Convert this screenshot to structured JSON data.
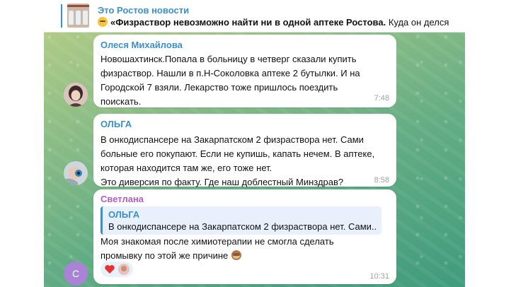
{
  "pinned": {
    "title": "Это Ростов новости",
    "bold_text": "«Физраствор невозможно найти ни в одной аптеке Ростова.",
    "rest_text": " Куда он делся"
  },
  "messages": [
    {
      "author": "Олеся Михайлова",
      "author_color": "#3a8fd1",
      "lines": [
        "Новошахтинск.Попала в больницу в четверг сказали купить",
        "физраствор. Нашли в п.Н-Соколовка аптеке 2 бутылки. И на",
        "Городской 7 взяли. Лекарство тоже пришлось поездить",
        "поискать."
      ],
      "time": "7:48"
    },
    {
      "author": "ОЛЬГА",
      "author_color": "#3a8fd1",
      "lines": [
        "В онкодиспансере на Закарпатском 2 физраствора нет. Сами",
        "больные его покупают. Если не купишь, капать нечем. В аптеке,",
        "которая находится там же, его тоже нет.",
        "Это диверсия по факту. Где наш доблестный Минздрав?"
      ],
      "time": "8:58"
    },
    {
      "author": "Светлана",
      "author_color": "#b060c0",
      "avatar_letter": "С",
      "avatar_color": "#a883d6",
      "quote": {
        "author": "ОЛЬГА",
        "text": "В онкодиспансере на Закарпатском 2 физраствора нет. Сами..."
      },
      "lines": [
        "Моя знакомая после химиотерапии не смогла сделать",
        "промывку по этой же причине"
      ],
      "time": "10:31"
    }
  ]
}
